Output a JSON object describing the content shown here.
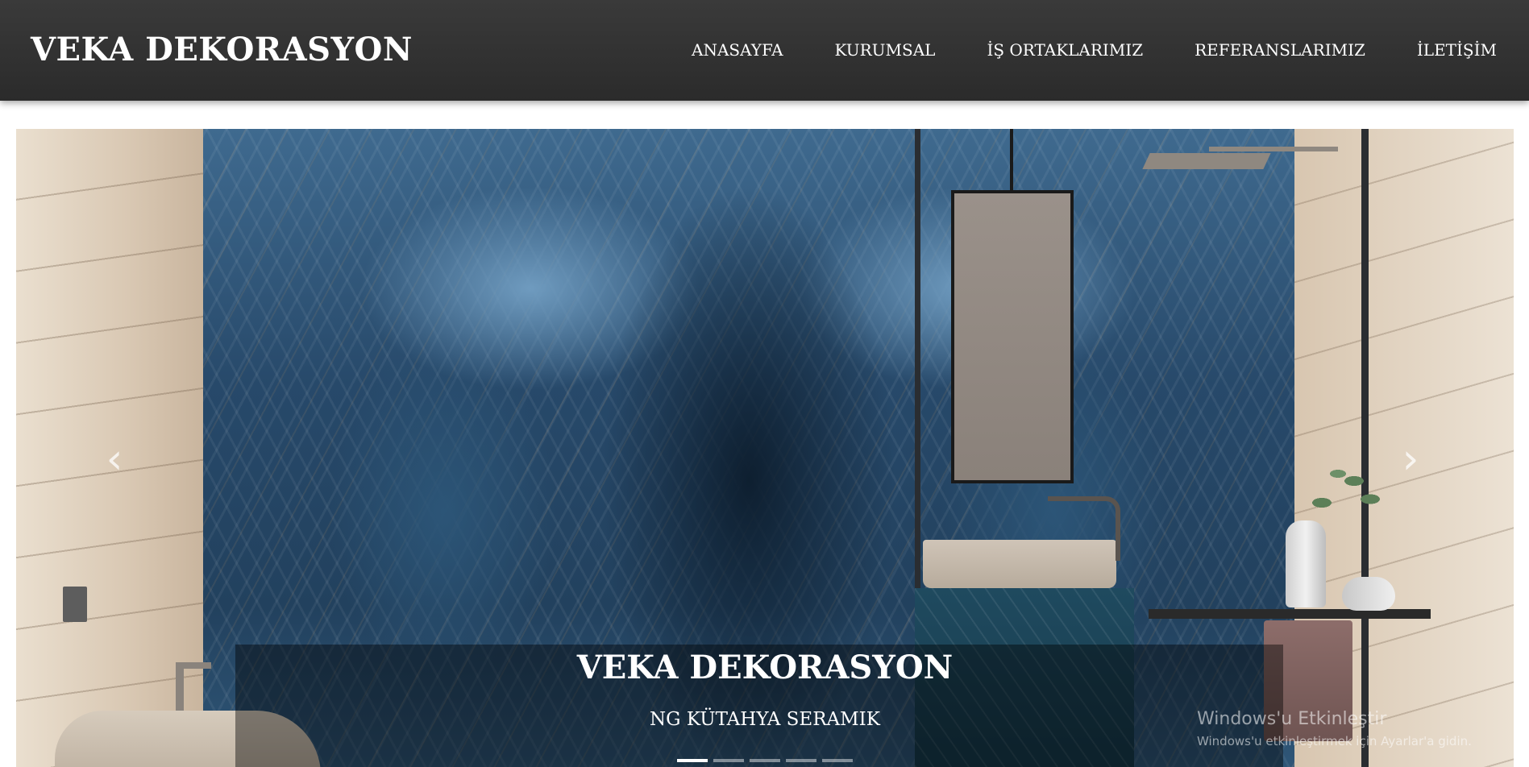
{
  "navbar": {
    "brand": "VEKA DEKORASYON",
    "menu": [
      {
        "label": "ANASAYFA"
      },
      {
        "label": "KURUMSAL"
      },
      {
        "label": "İŞ ORTAKLARIMIZ"
      },
      {
        "label": "REFERANSLARIMIZ"
      },
      {
        "label": "İLETİŞİM"
      }
    ]
  },
  "carousel": {
    "caption": {
      "title": "VEKA DEKORASYON",
      "subtitle": "NG KÜTAHYA SERAMIK"
    },
    "controls": {
      "prev_icon": "chevron-left-icon",
      "next_icon": "chevron-right-icon",
      "prev_glyph": "‹",
      "next_glyph": "›"
    },
    "indicators": {
      "count": 5,
      "active_index": 0
    }
  },
  "watermark": {
    "title": "Windows'u Etkinleştir",
    "subtitle": "Windows'u etkinleştirmek için Ayarlar'a gidin."
  },
  "colors": {
    "navbar_bg": "#2f2f2f",
    "text": "#ffffff"
  }
}
